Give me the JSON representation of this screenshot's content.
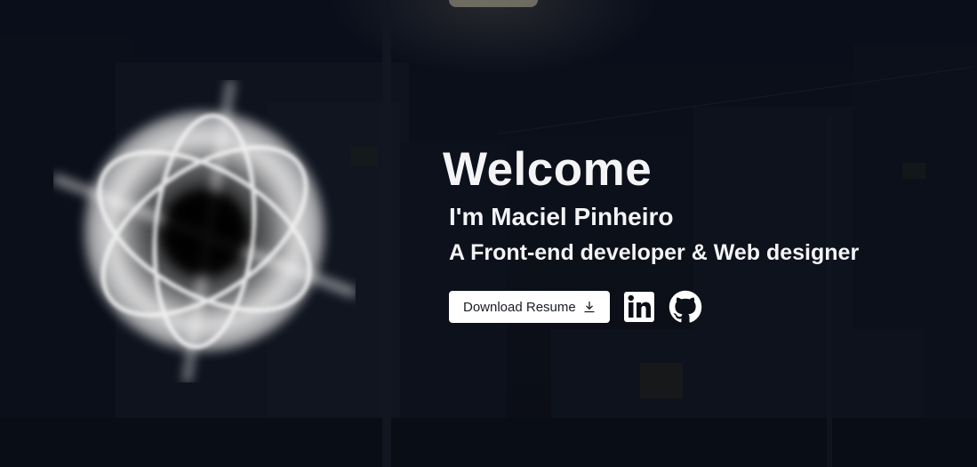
{
  "hero": {
    "title": "Welcome",
    "intro": "I'm Maciel Pinheiro",
    "role": "A Front-end developer & Web designer"
  },
  "actions": {
    "download_label": "Download Resume",
    "download_icon": "download-icon",
    "linkedin_icon": "linkedin-icon",
    "github_icon": "github-icon"
  },
  "colors": {
    "background": "#0b0e18",
    "text": "#f4f4f6",
    "button_bg": "#ffffff",
    "button_text": "#1a1d26"
  }
}
